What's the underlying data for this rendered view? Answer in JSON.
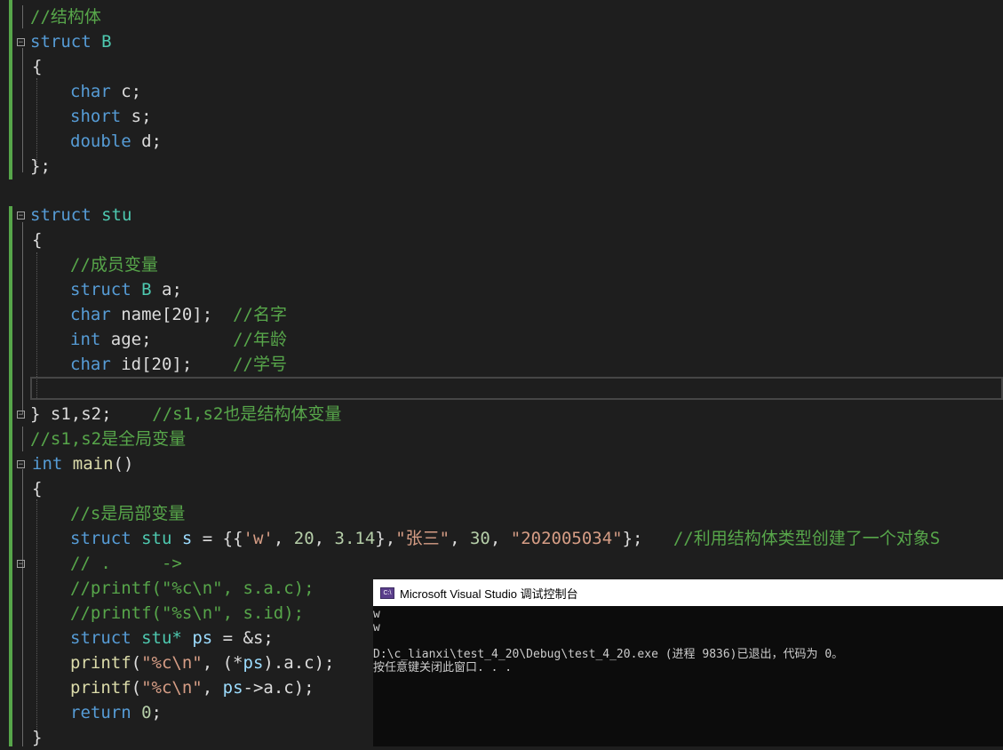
{
  "code": {
    "l1": "//结构体",
    "l2_kw": "struct",
    "l2_name": "B",
    "brace_open": "{",
    "f1_type": "char",
    "f1_name": "c",
    "f2_type": "short",
    "f2_name": "s",
    "f3_type": "double",
    "f3_name": "d",
    "brace_close_semi": "};",
    "s2_kw": "struct",
    "s2_name": "stu",
    "cm_members": "//成员变量",
    "m1_kw": "struct",
    "m1_type": "B",
    "m1_rest": "a;",
    "m2_kw": "char",
    "m2_rest": "name[20];",
    "m2_cm": "//名字",
    "m3_kw": "int",
    "m3_rest": "age;",
    "m3_cm": "//年龄",
    "m4_kw": "char",
    "m4_rest": "id[20];",
    "m4_cm": "//学号",
    "close_decl": "} s1,s2;",
    "close_cm": "//s1,s2也是结构体变量",
    "global_cm": "//s1,s2是全局变量",
    "main_kw": "int",
    "main_fn": "main",
    "main_paren": "()",
    "local_cm": "//s是局部变量",
    "init_kw": "struct",
    "init_type": "stu",
    "init_var": "s",
    "init_p1": " = {{",
    "init_c": "'w'",
    "init_p2": ", ",
    "init_n1": "20",
    "init_p3": ", ",
    "init_n2": "3.14",
    "init_p4": "},",
    "init_s1": "\"张三\"",
    "init_p5": ", ",
    "init_n3": "30",
    "init_p6": ", ",
    "init_s2": "\"202005034\"",
    "init_p7": "};",
    "init_cm": "//利用结构体类型创建了一个对象S",
    "cm_dot": "// .     ->",
    "cm_printf1": "//printf(\"%c\\n\", s.a.c);",
    "cm_printf2": "//printf(\"%s\\n\", s.id);",
    "ptr_kw": "struct",
    "ptr_type": "stu*",
    "ptr_var": "ps",
    "ptr_rest": " = &s;",
    "p1_fn": "printf",
    "p1_o": "(",
    "p1_str": "\"%c\\n\"",
    "p1_mid": ", (*",
    "p1_var": "ps",
    "p1_end": ").a.c);",
    "p2_fn": "printf",
    "p2_o": "(",
    "p2_str": "\"%c\\n\"",
    "p2_mid": ", ",
    "p2_var": "ps",
    "p2_end": "->a.c);",
    "ret_kw": "return",
    "ret_num": "0",
    "ret_semi": ";",
    "final_brace": "}"
  },
  "console": {
    "title": "Microsoft Visual Studio 调试控制台",
    "lines": [
      "w",
      "w",
      "",
      "D:\\c_lianxi\\test_4_20\\Debug\\test_4_20.exe (进程 9836)已退出，代码为 0。",
      "按任意键关闭此窗口. . ."
    ]
  },
  "icons": {
    "console": "console-app-icon",
    "fold": "collapse-icon"
  },
  "colors": {
    "keyword": "#569cd6",
    "comment": "#57a64a",
    "string": "#d69d85",
    "type": "#4ec9b0",
    "background": "#1e1e1e"
  }
}
